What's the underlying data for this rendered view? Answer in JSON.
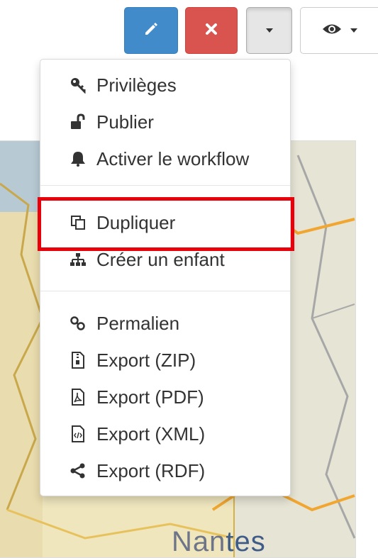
{
  "toolbar": {
    "edit_icon": "pencil-icon",
    "delete_icon": "times-icon",
    "more_icon": "caret-down-icon",
    "view_icon": "eye-icon"
  },
  "menu": {
    "items": [
      {
        "label": "Privilèges",
        "icon": "key-icon"
      },
      {
        "label": "Publier",
        "icon": "unlock-icon"
      },
      {
        "label": "Activer le workflow",
        "icon": "bell-icon"
      },
      {
        "label": "Dupliquer",
        "icon": "copy-icon"
      },
      {
        "label": "Créer un enfant",
        "icon": "sitemap-icon"
      },
      {
        "label": "Permalien",
        "icon": "link-icon"
      },
      {
        "label": "Export (ZIP)",
        "icon": "file-zip-icon"
      },
      {
        "label": "Export (PDF)",
        "icon": "file-pdf-icon"
      },
      {
        "label": "Export (XML)",
        "icon": "file-code-icon"
      },
      {
        "label": "Export (RDF)",
        "icon": "share-icon"
      }
    ]
  },
  "map": {
    "label_start": "Nan",
    "label_end": "tes"
  },
  "colors": {
    "edit": "#428bca",
    "delete": "#d9534f",
    "highlight": "#e8000b"
  }
}
